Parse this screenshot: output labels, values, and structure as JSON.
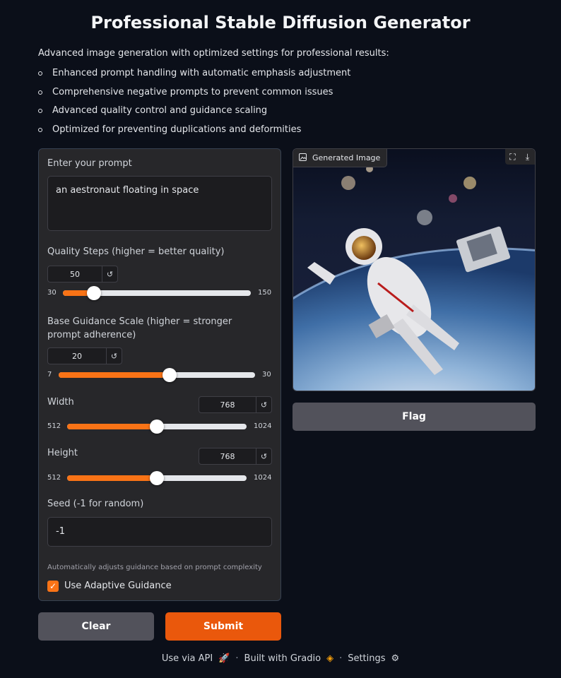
{
  "page": {
    "title": "Professional Stable Diffusion Generator",
    "intro": "Advanced image generation with optimized settings for professional results:",
    "bullets": [
      "Enhanced prompt handling with automatic emphasis adjustment",
      "Comprehensive negative prompts to prevent common issues",
      "Advanced quality control and guidance scaling",
      "Optimized for preventing duplications and deformities"
    ]
  },
  "form": {
    "prompt_label": "Enter your prompt",
    "prompt_value": "an aestronaut floating in space",
    "steps": {
      "label": "Quality Steps (higher = better quality)",
      "value": "50",
      "min": "30",
      "max": "150",
      "fraction": 0.1667
    },
    "guidance": {
      "label": "Base Guidance Scale (higher = stronger prompt adherence)",
      "value": "20",
      "min": "7",
      "max": "30",
      "fraction": 0.5652
    },
    "width": {
      "label": "Width",
      "value": "768",
      "min": "512",
      "max": "1024",
      "fraction": 0.5
    },
    "height": {
      "label": "Height",
      "value": "768",
      "min": "512",
      "max": "1024",
      "fraction": 0.5
    },
    "seed": {
      "label": "Seed (-1 for random)",
      "value": "-1"
    },
    "adaptive": {
      "info": "Automatically adjusts guidance based on prompt complexity",
      "label": "Use Adaptive Guidance",
      "checked": true
    },
    "reset_icon": "reset-icon"
  },
  "buttons": {
    "clear": "Clear",
    "submit": "Submit",
    "flag": "Flag"
  },
  "output": {
    "label": "Generated Image",
    "image_icon": "image-icon",
    "fullscreen_icon": "fullscreen-icon",
    "download_icon": "download-icon"
  },
  "footer": {
    "api": "Use via API",
    "built": "Built with Gradio",
    "settings": "Settings",
    "separator": "·"
  },
  "colors": {
    "accent": "#f97316",
    "primary_button": "#ea580c",
    "background": "#0b0f19",
    "panel": "#27272a"
  }
}
